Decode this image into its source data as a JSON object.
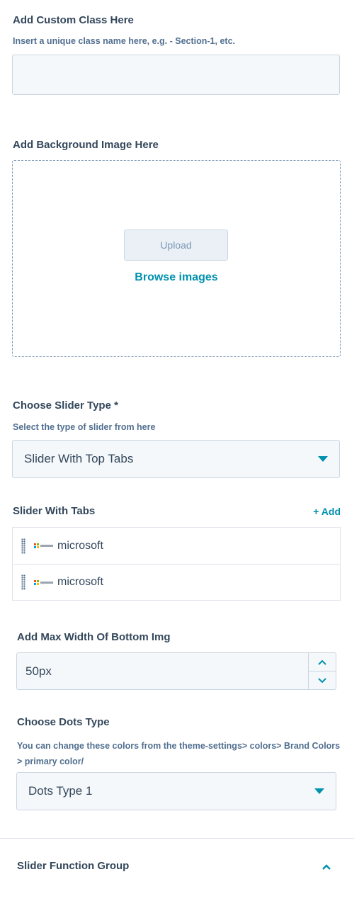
{
  "custom_class": {
    "label": "Add Custom Class Here",
    "help": "Insert a unique class name here, e.g. - Section-1, etc.",
    "value": ""
  },
  "background_image": {
    "label": "Add Background Image Here",
    "upload_label": "Upload",
    "browse_label": "Browse images"
  },
  "slider_type": {
    "label": "Choose Slider Type *",
    "help": "Select the type of slider from here",
    "selected": "Slider With Top Tabs"
  },
  "slider_tabs": {
    "label": "Slider With Tabs",
    "add_label": "+ Add",
    "items": [
      {
        "label": "microsoft"
      },
      {
        "label": "microsoft"
      }
    ]
  },
  "max_width": {
    "label": "Add Max Width Of Bottom Img",
    "value": "50px"
  },
  "dots_type": {
    "label": "Choose Dots Type",
    "help": "You can change these colors from the theme-settings> colors> Brand Colors > primary color/",
    "selected": "Dots Type 1"
  },
  "function_group": {
    "label": "Slider Function Group"
  },
  "colors": {
    "accent": "#0091ae",
    "text": "#33475b",
    "field_bg": "#f5f8fa",
    "border": "#cbd6e2"
  }
}
